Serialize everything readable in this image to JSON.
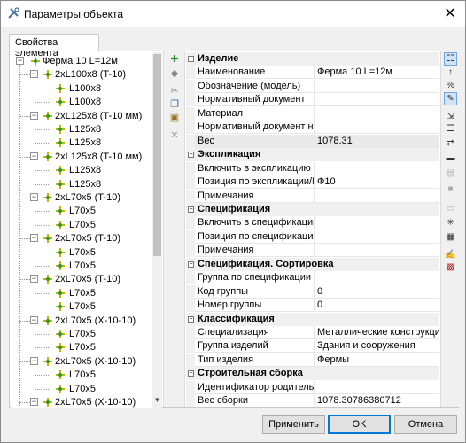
{
  "window": {
    "title": "Параметры объекта"
  },
  "tab": {
    "label": "Свойства элемента"
  },
  "tree": {
    "root": "Ферма 10 L=12м",
    "groups": [
      {
        "label": "2xL100x8 (T-10)",
        "children": [
          "L100x8",
          "L100x8"
        ]
      },
      {
        "label": "2xL125x8 (T-10 мм)",
        "children": [
          "L125x8",
          "L125x8"
        ]
      },
      {
        "label": "2xL125x8 (T-10 мм)",
        "children": [
          "L125x8",
          "L125x8"
        ]
      },
      {
        "label": "2xL70x5 (T-10)",
        "children": [
          "L70x5",
          "L70x5"
        ]
      },
      {
        "label": "2xL70x5 (T-10)",
        "children": [
          "L70x5",
          "L70x5"
        ]
      },
      {
        "label": "2xL70x5 (T-10)",
        "children": [
          "L70x5",
          "L70x5"
        ]
      },
      {
        "label": "2xL70x5 (X-10-10)",
        "children": [
          "L70x5",
          "L70x5"
        ]
      },
      {
        "label": "2xL70x5 (X-10-10)",
        "children": [
          "L70x5",
          "L70x5"
        ]
      },
      {
        "label": "2xL70x5 (X-10-10)",
        "children": []
      }
    ]
  },
  "properties": [
    {
      "category": "Изделие",
      "rows": [
        {
          "name": "Наименование",
          "value": "Ферма 10 L=12м"
        },
        {
          "name": "Обозначение (модель)",
          "value": ""
        },
        {
          "name": "Нормативный документ",
          "value": ""
        },
        {
          "name": "Материал",
          "value": ""
        },
        {
          "name": "Нормативный документ на ...",
          "value": ""
        },
        {
          "name": "Вес",
          "value": "1078.31",
          "selected": true
        }
      ]
    },
    {
      "category": "Экспликация",
      "rows": [
        {
          "name": "Включить в экспликацию",
          "value": ""
        },
        {
          "name": "Позиция по экспликации/М...",
          "value": "Ф10"
        },
        {
          "name": "Примечания",
          "value": ""
        }
      ]
    },
    {
      "category": "Спецификация",
      "rows": [
        {
          "name": "Включить в спецификацию",
          "value": ""
        },
        {
          "name": "Позиция по спецификации",
          "value": ""
        },
        {
          "name": "Примечания",
          "value": ""
        }
      ]
    },
    {
      "category": "Спецификация. Сортировка",
      "rows": [
        {
          "name": "Группа по спецификации",
          "value": ""
        },
        {
          "name": "Код группы",
          "value": "0"
        },
        {
          "name": "Номер группы",
          "value": "0"
        }
      ]
    },
    {
      "category": "Классификация",
      "rows": [
        {
          "name": "Специализация",
          "value": "Металлические конструкции"
        },
        {
          "name": "Группа изделий",
          "value": "Здания и сооружения"
        },
        {
          "name": "Тип изделия",
          "value": "Фермы"
        }
      ]
    },
    {
      "category": "Строительная сборка",
      "rows": [
        {
          "name": "Идентификатор родительс...",
          "value": ""
        },
        {
          "name": "Вес сборки",
          "value": "1078.30786380712"
        }
      ]
    }
  ],
  "buttons": {
    "apply": "Применить",
    "ok": "OK",
    "cancel": "Отмена"
  },
  "icons": {
    "app": "app-settings-icon",
    "node_color": "#c9b400",
    "node_dot": "#2e9a2e",
    "accent": "#0078d7"
  }
}
